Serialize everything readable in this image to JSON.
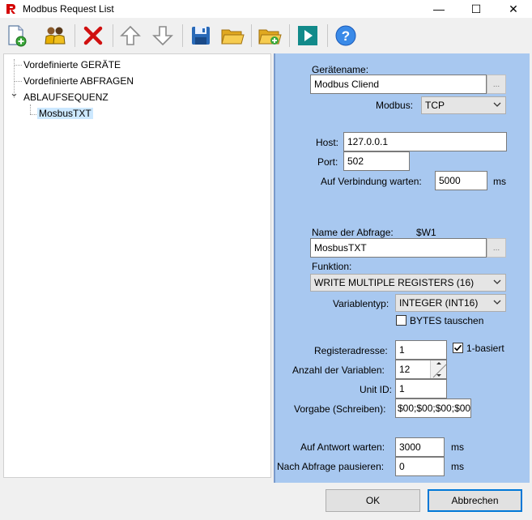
{
  "window": {
    "title": "Modbus Request List",
    "minimize_glyph": "—",
    "maximize_glyph": "☐",
    "close_glyph": "✕"
  },
  "toolbar": {
    "icons": [
      "new-document-icon",
      "users-icon",
      "delete-icon",
      "arrow-up-icon",
      "arrow-down-icon",
      "save-icon",
      "open-folder-icon",
      "new-folder-icon",
      "run-icon",
      "help-icon"
    ]
  },
  "tree": {
    "items": [
      {
        "label": "Vordefinierte GERÄTE"
      },
      {
        "label": "Vordefinierte ABFRAGEN"
      },
      {
        "label": "ABLAUFSEQUENZ"
      },
      {
        "label": "MosbusTXT"
      }
    ],
    "expander_glyph": "⌄"
  },
  "form": {
    "device_name_label": "Gerätename:",
    "device_name_value": "Modbus Cliend",
    "dots": "...",
    "modbus_label": "Modbus:",
    "modbus_value": "TCP",
    "host_label": "Host:",
    "host_value": "127.0.0.1",
    "port_label": "Port:",
    "port_value": "502",
    "connect_wait_label": "Auf Verbindung warten:",
    "connect_wait_value": "5000",
    "ms": "ms",
    "query_name_label": "Name der Abfrage:",
    "query_code": "$W1",
    "query_name_value": "MosbusTXT",
    "function_label": "Funktion:",
    "function_value": "WRITE MULTIPLE REGISTERS (16)",
    "vartype_label": "Variablentyp:",
    "vartype_value": "INTEGER (INT16)",
    "swap_bytes_label": "BYTES tauschen",
    "swap_bytes_checked": false,
    "register_address_label": "Registeradresse:",
    "register_address_value": "1",
    "one_based_label": "1-basiert",
    "one_based_checked": true,
    "var_count_label": "Anzahl der Variablen:",
    "var_count_value": "12",
    "unit_id_label": "Unit ID:",
    "unit_id_value": "1",
    "default_write_label": "Vorgabe (Schreiben):",
    "default_write_value": "$00;$00;$00;$00",
    "response_wait_label": "Auf Antwort warten:",
    "response_wait_value": "3000",
    "pause_label": "Nach Abfrage pausieren:",
    "pause_value": "0"
  },
  "buttons": {
    "ok": "OK",
    "cancel": "Abbrechen"
  },
  "colors": {
    "form_bg": "#a8c8f0",
    "selection": "#cce8ff",
    "accent": "#0078d7"
  }
}
